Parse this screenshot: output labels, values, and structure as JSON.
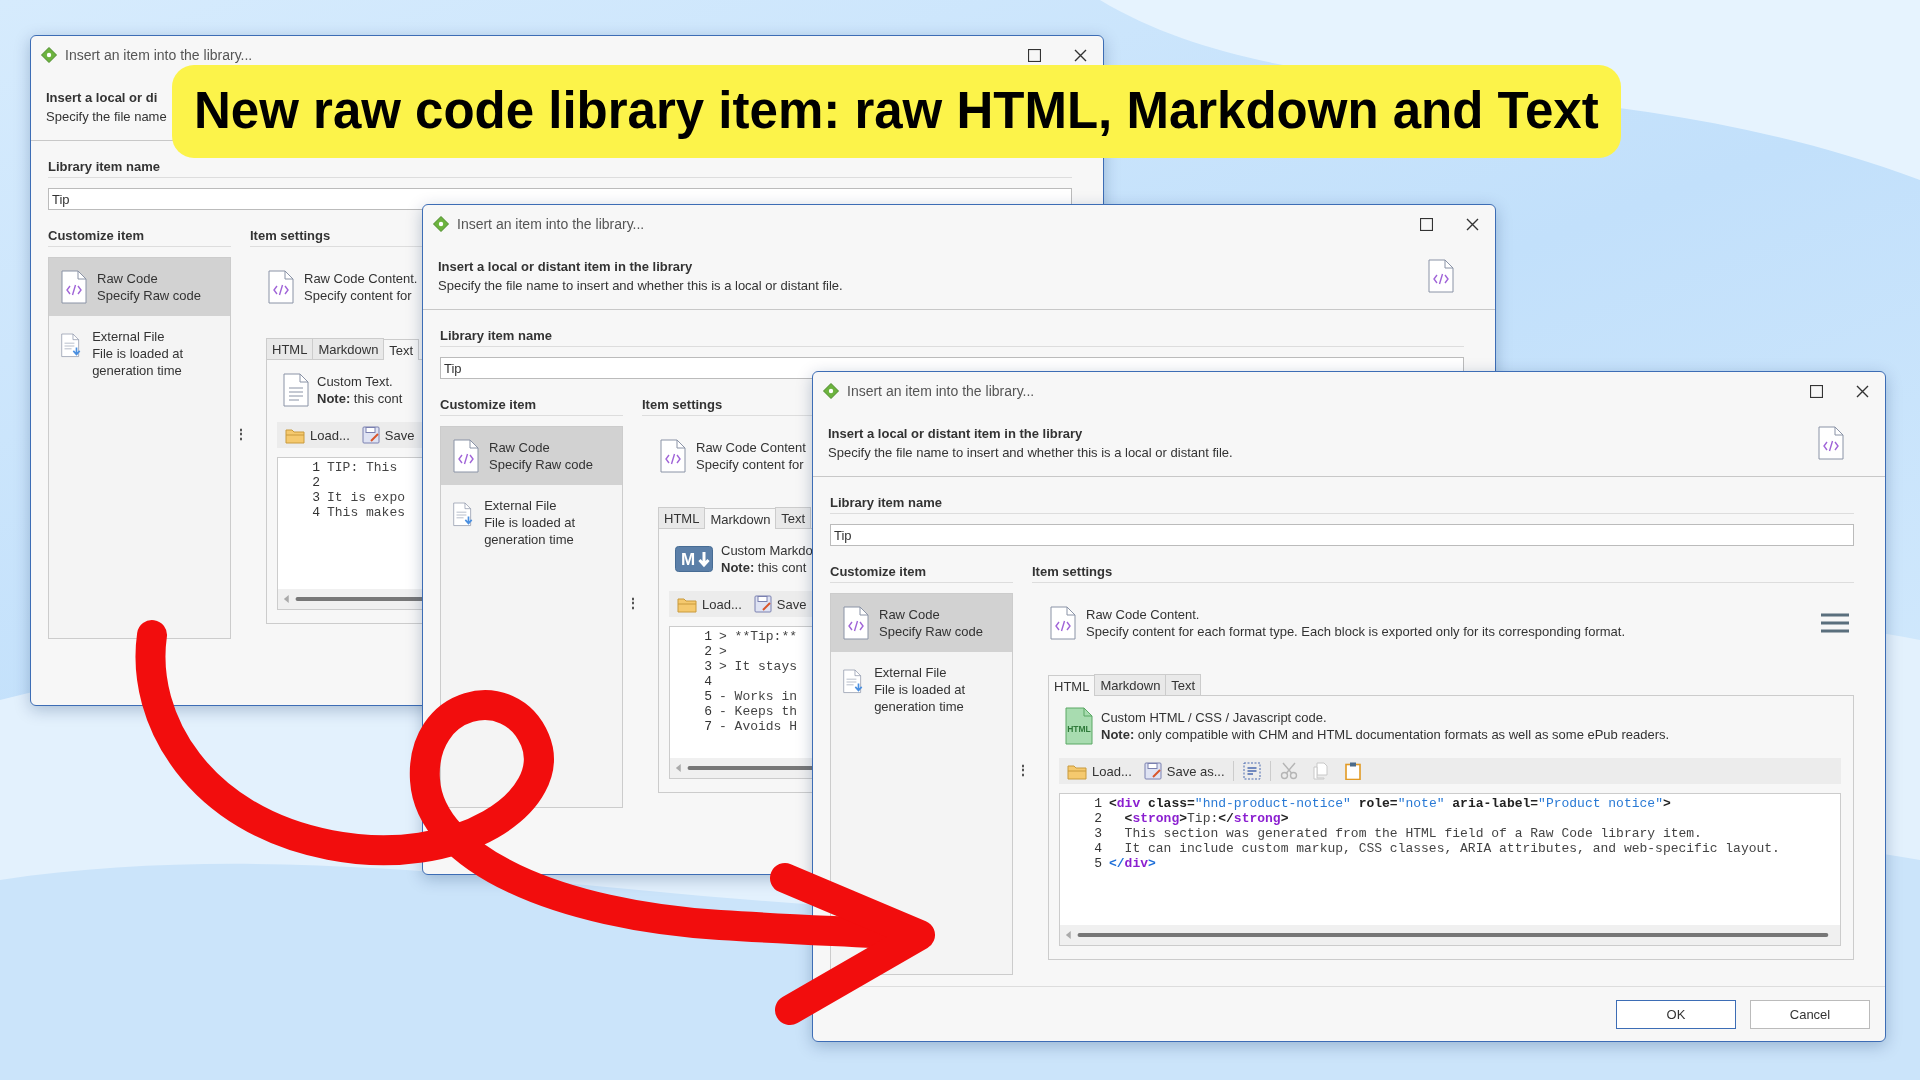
{
  "banner": {
    "text": "New raw code library item: raw HTML, Markdown and Text"
  },
  "windows": [
    {
      "title": "Insert an item into the library...",
      "heading": "Insert a local or di",
      "subtitle": "Specify the file name",
      "name_label": "Library item name",
      "name_value": "Tip",
      "customize_label": "Customize item",
      "settings_label": "Item settings",
      "splitter": "⋮",
      "items": [
        {
          "kind": "raw",
          "title": "Raw Code",
          "subtitle": "Specify Raw code",
          "selected": true
        },
        {
          "kind": "file",
          "title": "External File",
          "subtitle": "File is loaded at generation time",
          "selected": false
        }
      ],
      "content_title": "Raw Code Content.",
      "content_subtitle": "Specify content for",
      "tabs": [
        {
          "label": "HTML",
          "selected": false
        },
        {
          "label": "Markdown",
          "selected": false
        },
        {
          "label": "Text",
          "selected": true
        }
      ],
      "panel": {
        "kind": "text",
        "title": "Custom Text.",
        "note": "**Note:** this cont"
      },
      "toolbar": [
        {
          "kind": "load",
          "label": "Load..."
        },
        {
          "kind": "save",
          "label": "Save"
        }
      ],
      "code": [
        {
          "number": "1",
          "tokens": [
            {
              "kind": "text",
              "text": "TIP: This"
            }
          ]
        },
        {
          "number": "2"
        },
        {
          "number": "3",
          "tokens": [
            {
              "kind": "text",
              "text": "It is expo"
            }
          ]
        },
        {
          "number": "4",
          "tokens": [
            {
              "kind": "text",
              "text": "This makes"
            }
          ]
        }
      ]
    },
    {
      "title": "Insert an item into the library...",
      "heading": "Insert a local or distant item in the library",
      "subtitle": "Specify the file name to insert and whether this is a local or distant file.",
      "name_label": "Library item name",
      "name_value": "Tip",
      "customize_label": "Customize item",
      "settings_label": "Item settings",
      "splitter": "⋮",
      "items": [
        {
          "kind": "raw",
          "title": "Raw Code",
          "subtitle": "Specify Raw code",
          "selected": true
        },
        {
          "kind": "file",
          "title": "External File",
          "subtitle": "File is loaded at generation time",
          "selected": false
        }
      ],
      "content_title": "Raw Code Content",
      "content_subtitle": "Specify content for",
      "tabs": [
        {
          "label": "HTML",
          "selected": false
        },
        {
          "label": "Markdown",
          "selected": true
        },
        {
          "label": "Text",
          "selected": false
        }
      ],
      "panel": {
        "kind": "markdown",
        "icon_label": "M",
        "title": "Custom Markdo",
        "note": "**Note:** this cont"
      },
      "toolbar": [
        {
          "kind": "load",
          "label": "Load..."
        },
        {
          "kind": "save",
          "label": "Save"
        }
      ],
      "code": [
        {
          "number": "1",
          "tokens": [
            {
              "kind": "text",
              "text": "> **Tip:**"
            }
          ]
        },
        {
          "number": "2",
          "tokens": [
            {
              "kind": "text",
              "text": ">"
            }
          ]
        },
        {
          "number": "3",
          "tokens": [
            {
              "kind": "text",
              "text": "> It stays"
            }
          ]
        },
        {
          "number": "4"
        },
        {
          "number": "5",
          "tokens": [
            {
              "kind": "text",
              "text": "- Works in"
            }
          ]
        },
        {
          "number": "6",
          "tokens": [
            {
              "kind": "text",
              "text": "- Keeps th"
            }
          ]
        },
        {
          "number": "7",
          "tokens": [
            {
              "kind": "text",
              "text": "- Avoids H"
            }
          ]
        }
      ]
    },
    {
      "title": "Insert an item into the library...",
      "heading": "Insert a local or distant item in the library",
      "subtitle": "Specify the file name to insert and whether this is a local or distant file.",
      "name_label": "Library item name",
      "name_value": "Tip",
      "customize_label": "Customize item",
      "settings_label": "Item settings",
      "splitter": "⋮",
      "items": [
        {
          "kind": "raw",
          "title": "Raw Code",
          "subtitle": "Specify Raw code",
          "selected": true
        },
        {
          "kind": "file",
          "title": "External File",
          "subtitle": "File is loaded at generation time",
          "selected": false
        }
      ],
      "content_title": "Raw Code Content.",
      "content_subtitle": "Specify content for each format type. Each block is exported only for its corresponding format.",
      "tabs": [
        {
          "label": "HTML",
          "selected": true
        },
        {
          "label": "Markdown",
          "selected": false
        },
        {
          "label": "Text",
          "selected": false
        }
      ],
      "panel": {
        "kind": "html",
        "icon_label": "HTML",
        "title": "Custom HTML / CSS / Javascript code.",
        "note": "**Note:** only compatible with CHM and HTML documentation formats as well as some ePub readers."
      },
      "toolbar": [
        {
          "kind": "load",
          "label": "Load..."
        },
        {
          "kind": "save",
          "label": "Save as..."
        },
        {
          "kind": "format",
          "disabled": false
        },
        {
          "kind": "cut",
          "disabled": true
        },
        {
          "kind": "copy",
          "disabled": true
        },
        {
          "kind": "paste",
          "disabled": false
        }
      ],
      "code": [
        {
          "number": "1",
          "tokens": [
            {
              "kind": "punct",
              "text": "<"
            },
            {
              "kind": "tag",
              "text": "div"
            },
            {
              "kind": "attr",
              "text": " class="
            },
            {
              "kind": "string",
              "text": "\"hnd-product-notice\""
            },
            {
              "kind": "attr",
              "text": " role="
            },
            {
              "kind": "string",
              "text": "\"note\""
            },
            {
              "kind": "attr",
              "text": " aria-label="
            },
            {
              "kind": "string",
              "text": "\"Product notice\""
            },
            {
              "kind": "punct",
              "text": ">"
            }
          ]
        },
        {
          "number": "2",
          "tokens": [
            {
              "kind": "punct",
              "text": "  <"
            },
            {
              "kind": "tag",
              "text": "strong"
            },
            {
              "kind": "punct",
              "text": ">"
            },
            {
              "kind": "text",
              "text": "Tip:"
            },
            {
              "kind": "punct",
              "text": "</"
            },
            {
              "kind": "tag",
              "text": "strong"
            },
            {
              "kind": "punct",
              "text": ">"
            }
          ]
        },
        {
          "number": "3",
          "tokens": [
            {
              "kind": "text",
              "text": "  This section was generated from the HTML field of a Raw Code library item."
            }
          ]
        },
        {
          "number": "4",
          "tokens": [
            {
              "kind": "text",
              "text": "  It can include custom markup, CSS classes, ARIA attributes, and web-specific layout."
            }
          ]
        },
        {
          "number": "5",
          "tokens": [
            {
              "kind": "punct_blue",
              "text": "</"
            },
            {
              "kind": "tag",
              "text": "div"
            },
            {
              "kind": "punct_blue",
              "text": ">"
            }
          ]
        }
      ],
      "buttons": [
        {
          "label": "OK",
          "default": true
        },
        {
          "label": "Cancel",
          "default": false
        }
      ]
    }
  ]
}
